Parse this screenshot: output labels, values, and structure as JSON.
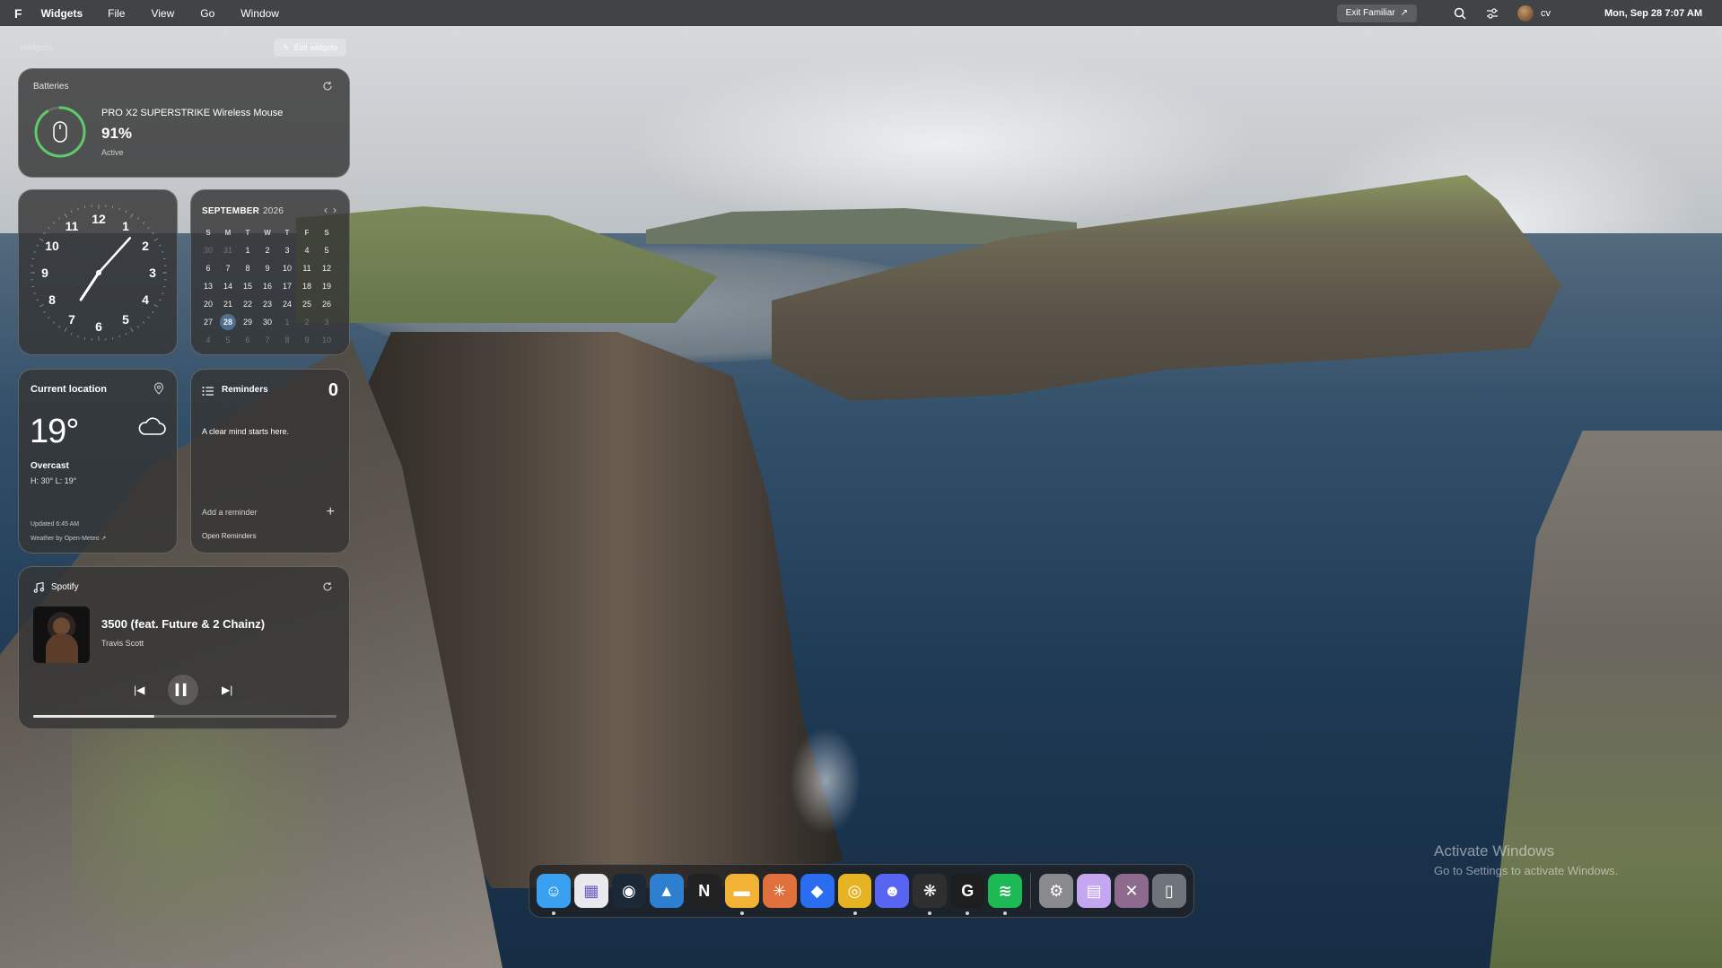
{
  "menubar": {
    "logo": "F",
    "app_name": "Widgets",
    "menus": [
      "File",
      "View",
      "Go",
      "Window"
    ],
    "exit_button": "Exit Familiar",
    "user": "cv",
    "datetime": "Mon, Sep 28 7:07 AM"
  },
  "widgets_panel": {
    "title": "Widgets",
    "edit_button": "Edit widgets"
  },
  "batteries": {
    "title": "Batteries",
    "device": "PRO X2 SUPERSTRIKE Wireless Mouse",
    "percent": "91%",
    "level": 0.91,
    "status": "Active",
    "ring_color": "#5ecb6b"
  },
  "clock": {
    "numbers": [
      "12",
      "1",
      "2",
      "3",
      "4",
      "5",
      "6",
      "7",
      "8",
      "9",
      "10",
      "11"
    ],
    "hour": 7,
    "minute": 7
  },
  "calendar": {
    "month": "SEPTEMBER",
    "year": "2026",
    "weekdays": [
      "S",
      "M",
      "T",
      "W",
      "T",
      "F",
      "S"
    ],
    "days": [
      [
        "30",
        "31",
        "1",
        "2",
        "3",
        "4",
        "5"
      ],
      [
        "6",
        "7",
        "8",
        "9",
        "10",
        "11",
        "12"
      ],
      [
        "13",
        "14",
        "15",
        "16",
        "17",
        "18",
        "19"
      ],
      [
        "20",
        "21",
        "22",
        "23",
        "24",
        "25",
        "26"
      ],
      [
        "27",
        "28",
        "29",
        "30",
        "1",
        "2",
        "3"
      ],
      [
        "4",
        "5",
        "6",
        "7",
        "8",
        "9",
        "10"
      ]
    ],
    "today": "28",
    "today_color": "#4f6f8f"
  },
  "weather": {
    "location": "Current location",
    "temperature": "19°",
    "condition": "Overcast",
    "high_low": "H: 30°  L: 19°",
    "updated": "Updated 6:45 AM",
    "source": "Weather by Open-Meteo ↗"
  },
  "reminders": {
    "title": "Reminders",
    "count": "0",
    "empty_text": "A clear mind starts here.",
    "add_placeholder": "Add a reminder",
    "open_link": "Open Reminders"
  },
  "spotify": {
    "title": "Spotify",
    "track": "3500 (feat. Future & 2 Chainz)",
    "artist": "Travis Scott",
    "progress": 0.4
  },
  "dock": {
    "apps": [
      {
        "name": "finder",
        "glyph": "☺",
        "bg": "#3aa0f0",
        "running": true
      },
      {
        "name": "launchpad",
        "glyph": "▦",
        "bg": "#e8e8ee",
        "running": false
      },
      {
        "name": "steam",
        "glyph": "◉",
        "bg": "#1b2838",
        "running": false
      },
      {
        "name": "photos",
        "glyph": "▲",
        "bg": "#2f7fd0",
        "running": false
      },
      {
        "name": "notion",
        "glyph": "N",
        "bg": "#222222",
        "running": false
      },
      {
        "name": "files",
        "glyph": "▬",
        "bg": "#f2b233",
        "running": true
      },
      {
        "name": "claude",
        "glyph": "✳",
        "bg": "#e0703c",
        "running": false
      },
      {
        "name": "roblox",
        "glyph": "◆",
        "bg": "#2b6df0",
        "running": false
      },
      {
        "name": "chrome",
        "glyph": "◎",
        "bg": "#e6b422",
        "running": true
      },
      {
        "name": "discord",
        "glyph": "☻",
        "bg": "#5865f2",
        "running": false
      },
      {
        "name": "chatgpt",
        "glyph": "❋",
        "bg": "#2f2f2f",
        "running": true
      },
      {
        "name": "logitech",
        "glyph": "G",
        "bg": "#1e1e1e",
        "running": true
      },
      {
        "name": "spotify",
        "glyph": "≋",
        "bg": "#1db954",
        "running": true
      }
    ],
    "utilities": [
      {
        "name": "settings",
        "glyph": "⚙",
        "bg": "#8a8a8e"
      },
      {
        "name": "widgets",
        "glyph": "▤",
        "bg": "#c5a6f0"
      },
      {
        "name": "close",
        "glyph": "✕",
        "bg": "#8e6a8e"
      },
      {
        "name": "trash",
        "glyph": "▯",
        "bg": "#6e747a"
      }
    ]
  },
  "watermark": {
    "line1": "Activate Windows",
    "line2": "Go to Settings to activate Windows."
  }
}
